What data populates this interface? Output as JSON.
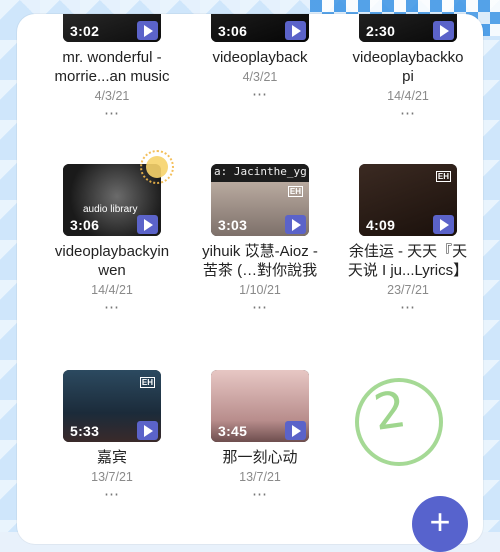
{
  "videos": [
    {
      "duration": "3:02",
      "title": "mr. wonderful -\nmorrie...an music",
      "date": "4/3/21"
    },
    {
      "duration": "3:06",
      "title": "videoplayback",
      "date": "4/3/21"
    },
    {
      "duration": "2:30",
      "title": "videoplaybackko\npi",
      "date": "14/4/21"
    },
    {
      "duration": "3:06",
      "title": "videoplaybackyin\nwen",
      "date": "14/4/21",
      "overlay": "audio library"
    },
    {
      "duration": "3:03",
      "title": "yihuik 苡慧-Aioz -\n苦茶 (…對你說我",
      "date": "1/10/21",
      "overlay": "a: Jacinthe_yg",
      "tag": "EH"
    },
    {
      "duration": "4:09",
      "title": "余佳运 - 天天『天\n天说 I ju...Lyrics】",
      "date": "23/7/21",
      "tag": "EH"
    },
    {
      "duration": "5:33",
      "title": "嘉宾",
      "date": "13/7/21",
      "tag": "EH"
    },
    {
      "duration": "3:45",
      "title": "那一刻心动",
      "date": "13/7/21"
    }
  ],
  "more_icon": "⋯",
  "fab_label": "+",
  "annotation": "2"
}
